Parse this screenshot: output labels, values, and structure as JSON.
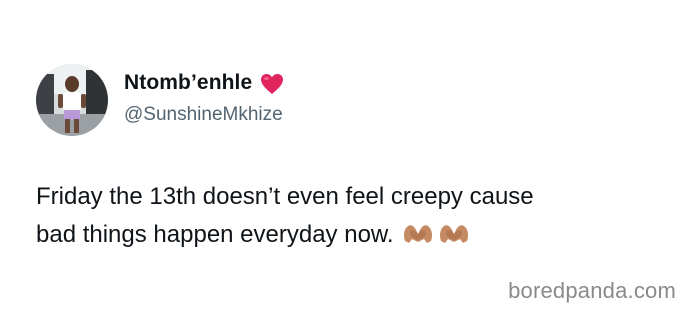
{
  "tweet": {
    "display_name": "Ntomb’enhle",
    "name_emoji": "red-heart-icon",
    "handle": "@SunshineMkhize",
    "text_line_1": "Friday the 13th doesn’t even feel creepy cause",
    "text_line_2": "bad things happen everyday now.",
    "text_emojis": [
      "heart-hands-icon",
      "heart-hands-icon"
    ]
  },
  "watermark": {
    "text": "boredpanda.com"
  },
  "colors": {
    "text_primary": "#0f1419",
    "text_secondary": "#536471",
    "heart": "#e0245e",
    "watermark": "#8a8a8a"
  }
}
